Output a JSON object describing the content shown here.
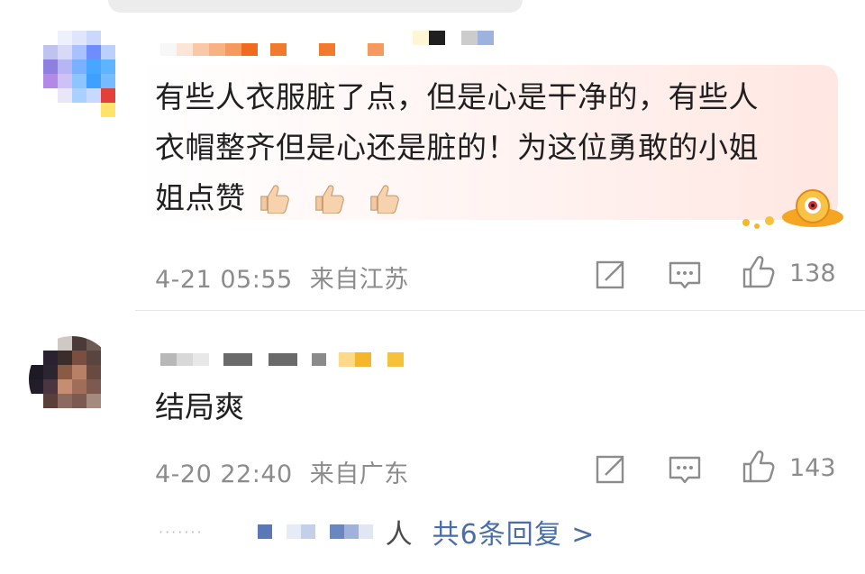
{
  "comments": [
    {
      "text_lines": [
        "有些人衣服脏了点，但是心是干净的，有些人",
        "衣帽整齐但是心还是脏的！为这位勇敢的小姐",
        "姐点赞"
      ],
      "emoji": "thumbs-up",
      "timestamp": "4-21 05:55",
      "location": "来自江苏",
      "likes": "138"
    },
    {
      "text": "结局爽",
      "timestamp": "4-20 22:40",
      "location": "来自广东",
      "likes": "143"
    }
  ],
  "replies": {
    "partial_name_suffix": "人",
    "summary": "共6条回复 >"
  },
  "colors": {
    "text": "#1f1f1f",
    "meta": "#8c8c8c",
    "link": "#4b6ea8",
    "bubble_tint": "#ffe7e2"
  },
  "icons": [
    "share-icon",
    "comment-icon",
    "like-icon",
    "thumbs-up-emoji"
  ]
}
